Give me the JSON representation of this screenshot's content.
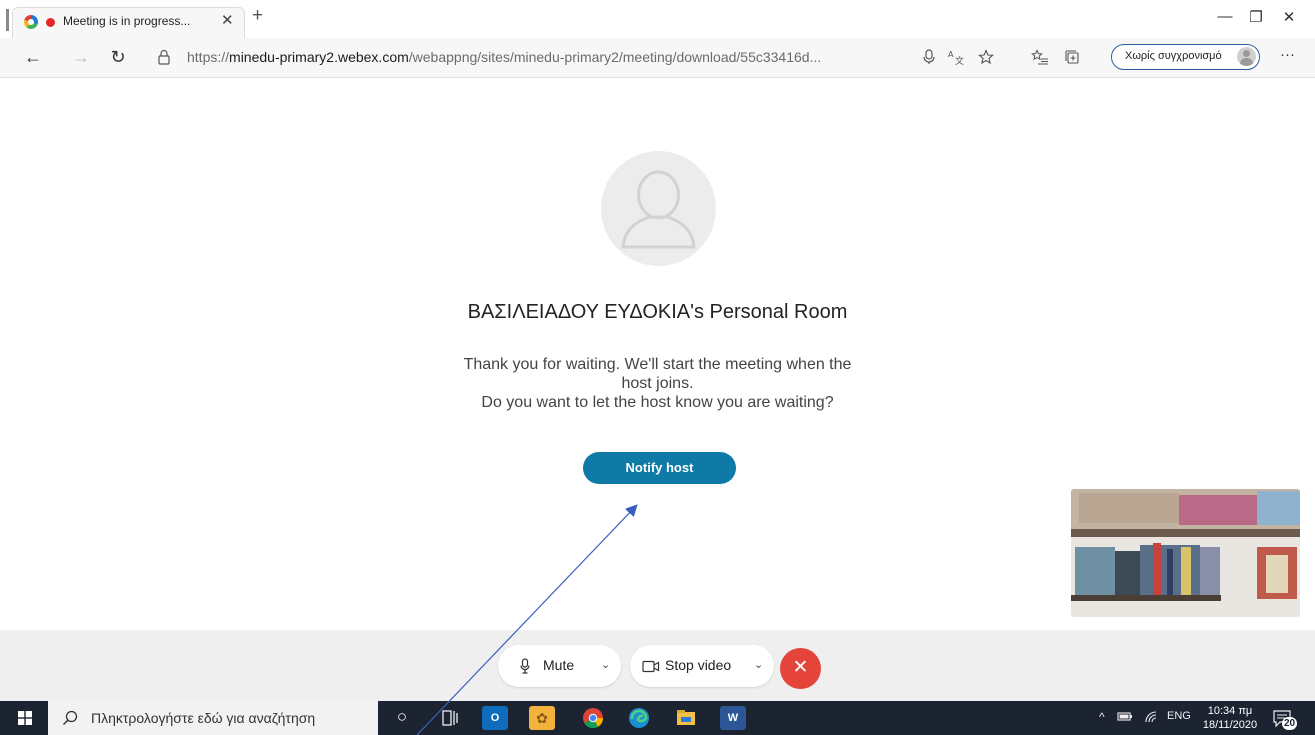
{
  "browser": {
    "tab": {
      "title": "Meeting is in progress...",
      "close_glyph": "✕",
      "new_tab_glyph": "+"
    },
    "window_controls": {
      "minimize": "—",
      "restore": "❐",
      "close": "✕"
    },
    "nav": {
      "back": "←",
      "forward": "→",
      "refresh": "↻"
    },
    "url": {
      "scheme": "https://",
      "domain": "minedu-primary2.webex.com",
      "path": "/webappng/sites/minedu-primary2/meeting/download/55c33416d..."
    },
    "toolbar_icons": [
      "microphone-icon",
      "translate-icon",
      "favorite-star-icon",
      "favorites-list-icon",
      "collections-icon"
    ],
    "profile": {
      "label": "Χωρίς συγχρονισμό"
    },
    "more": "···"
  },
  "meeting": {
    "room_title": "ΒΑΣΙΛΕΙΑΔΟΥ ΕΥΔΟΚΙΑ's Personal Room",
    "waiting_line1": "Thank you for waiting. We'll start the meeting when the",
    "waiting_line2": "host joins.",
    "waiting_line3": "Do you want to let the host know you are waiting?",
    "notify_button": "Notify host",
    "accent_color": "#0f7aa6"
  },
  "controls": {
    "mute_label": "Mute",
    "stop_video_label": "Stop video",
    "chevron": "⌄",
    "leave_glyph": "✕",
    "leave_color": "#e5443a"
  },
  "taskbar": {
    "search_placeholder": "Πληκτρολογήστε εδώ για αναζήτηση",
    "apps": [
      {
        "name": "cortana",
        "glyph": "○"
      },
      {
        "name": "task-view",
        "glyph": "⧉"
      },
      {
        "name": "outlook",
        "glyph": "O"
      },
      {
        "name": "photos",
        "glyph": "✿"
      },
      {
        "name": "chrome",
        "glyph": ""
      },
      {
        "name": "edge",
        "glyph": ""
      },
      {
        "name": "file-explorer",
        "glyph": ""
      },
      {
        "name": "word",
        "glyph": "W"
      }
    ],
    "tray": {
      "chevron": "^",
      "language": "ENG"
    },
    "clock": {
      "time": "10:34 πμ",
      "date": "18/11/2020"
    },
    "notification_count": "20"
  }
}
